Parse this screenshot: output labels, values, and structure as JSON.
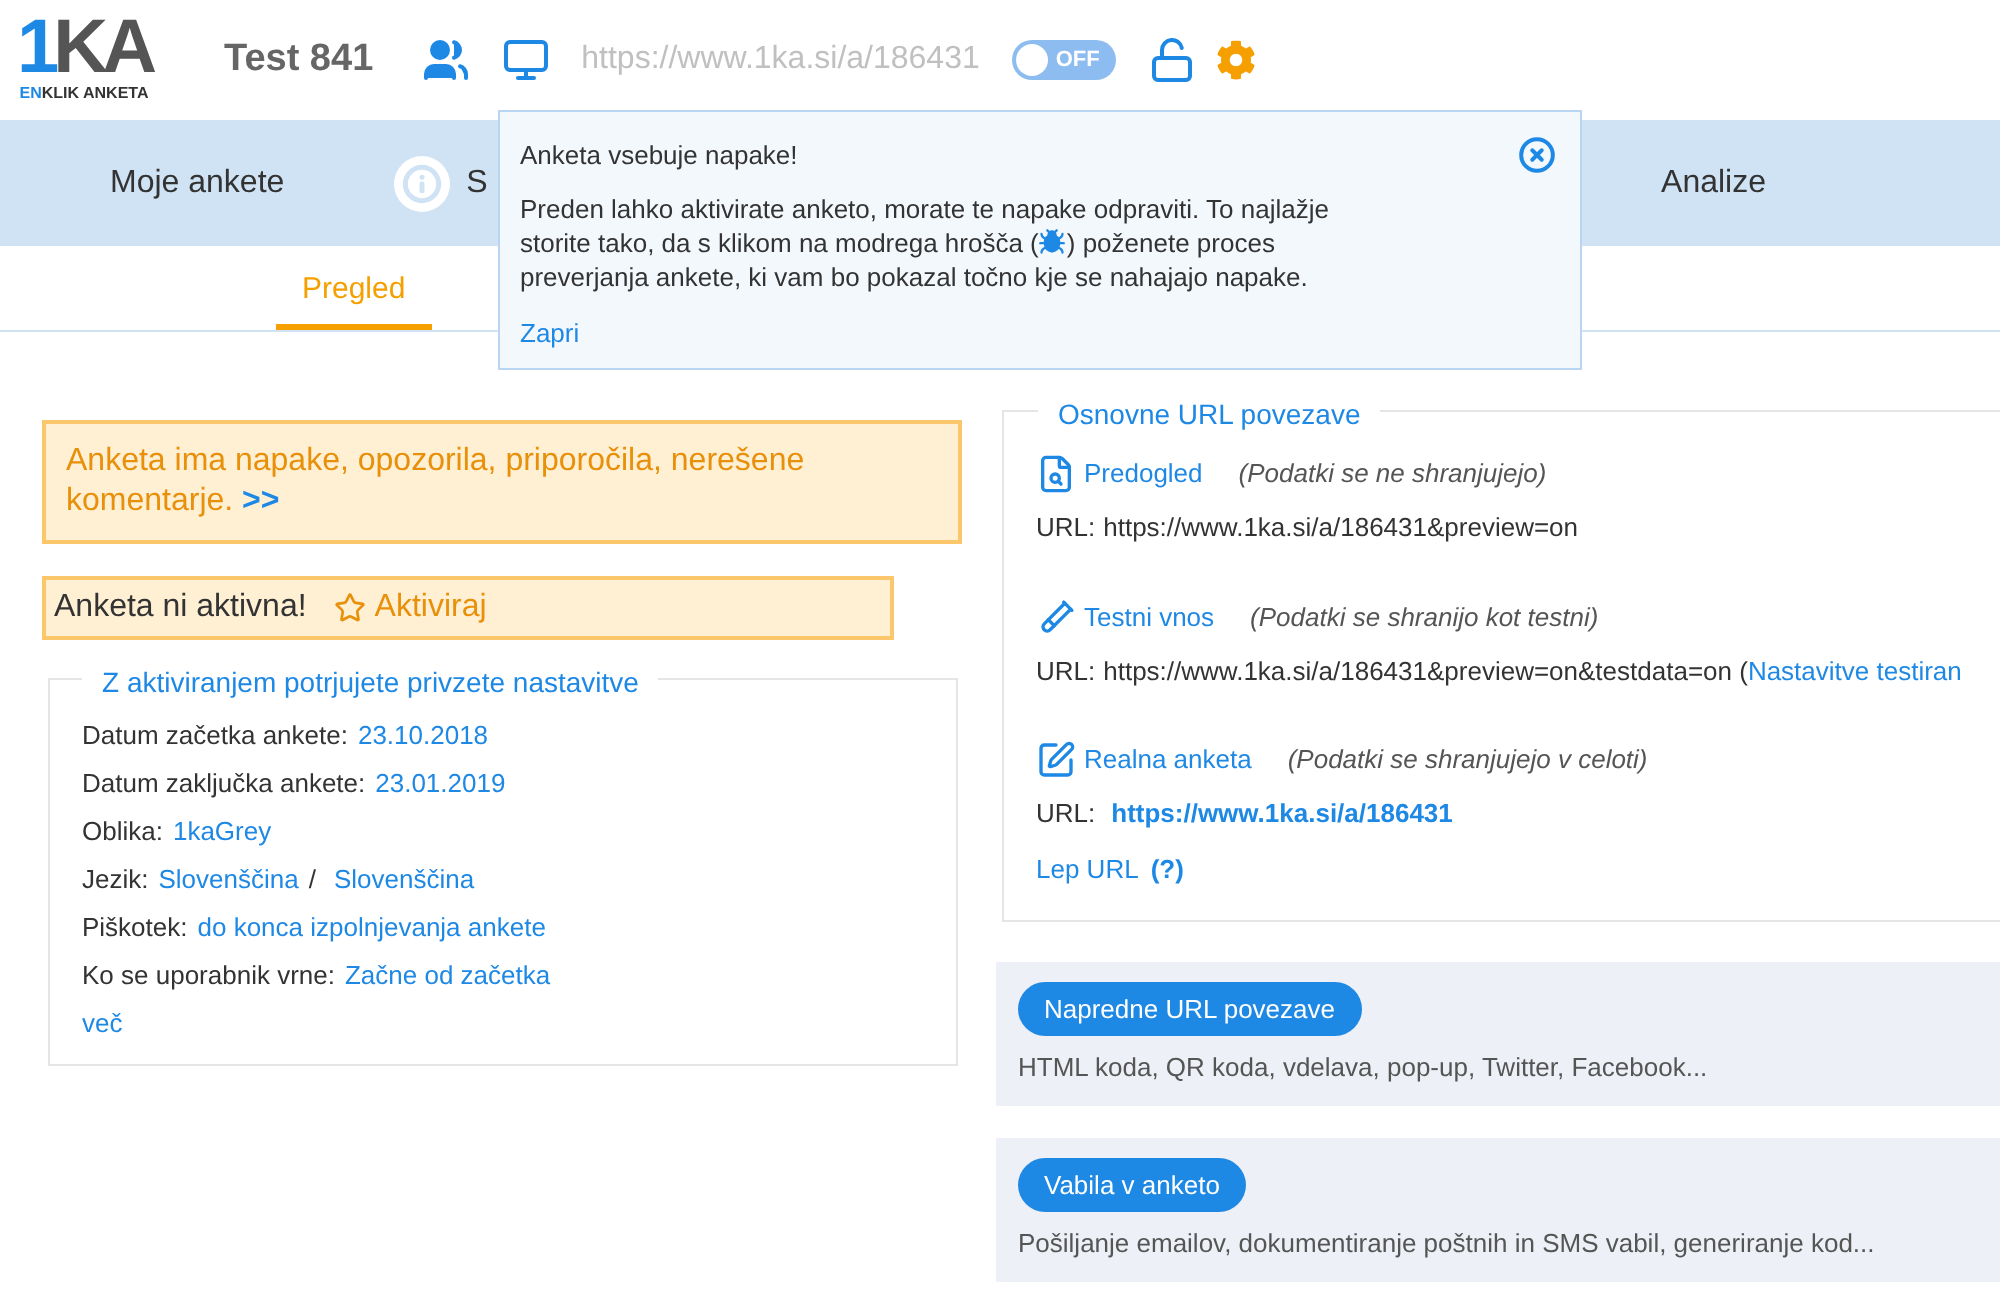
{
  "header": {
    "logo": {
      "mark": "1KA",
      "sub_accent": "EN",
      "sub_rest": "KLIK ANKETA"
    },
    "title": "Test 841",
    "url": "https://www.1ka.si/a/186431",
    "toggle": {
      "label": "OFF",
      "on": false
    }
  },
  "nav": {
    "items": [
      {
        "label": "Moje ankete",
        "kind": "plain"
      },
      {
        "label": "S",
        "kind": "info"
      },
      {
        "label": "Analize",
        "kind": "plain"
      }
    ]
  },
  "subtabs": [
    {
      "label": "Pregled",
      "selected": true
    }
  ],
  "popup": {
    "title": "Anketa vsebuje napake!",
    "message_lines": [
      {
        "before": "Preden lahko aktivirate anketo, morate te napake odpraviti. To najlažje"
      },
      {
        "before": "storite tako, da s klikom na modrega hrošča (",
        "after": ") poženete proces"
      },
      {
        "before": "preverjanja ankete, ki vam bo pokazal točno kje se nahajajo napake."
      }
    ],
    "close_link": "Zapri"
  },
  "warning": {
    "text": "Anketa ima napake, opozorila, priporočila, nerešene komentarje.",
    "link": ">>"
  },
  "status": {
    "text": "Anketa ni aktivna!",
    "action": "Aktiviraj"
  },
  "settings": {
    "legend": "Z aktiviranjem potrjujete privzete nastavitve",
    "separator": "/",
    "rows": [
      {
        "label": "Datum začetka ankete:",
        "values": [
          "23.10.2018"
        ]
      },
      {
        "label": "Datum zaključka ankete:",
        "values": [
          "23.01.2019"
        ]
      },
      {
        "label": "Oblika:",
        "values": [
          "1kaGrey"
        ]
      },
      {
        "label": "Jezik:",
        "values": [
          "Slovenščina",
          "Slovenščina"
        ]
      },
      {
        "label": "Piškotek:",
        "values": [
          "do konca izpolnjevanja ankete"
        ]
      },
      {
        "label": "Ko se uporabnik vrne:",
        "values": [
          "Začne od začetka"
        ]
      }
    ],
    "more": "več"
  },
  "urls": {
    "legend": "Osnovne URL povezave",
    "items": [
      {
        "kind": "preview",
        "link": "Predogled",
        "note": "(Podatki se ne shranjujejo)",
        "url_label": "URL:",
        "url": "https://www.1ka.si/a/186431&preview=on"
      },
      {
        "kind": "test",
        "link": "Testni vnos",
        "note": "(Podatki se shranijo kot testni)",
        "url_label": "URL:",
        "url": "https://www.1ka.si/a/186431&preview=on&testdata=on (",
        "extra_link": "Nastavitve testiran"
      },
      {
        "kind": "real",
        "link": "Realna anketa",
        "note": "(Podatki se shranjujejo v celoti)",
        "url_label": "URL:",
        "url_link": "https://www.1ka.si/a/186431"
      }
    ],
    "lep_url": "Lep URL",
    "help": "(?)"
  },
  "cards": [
    {
      "button": "Napredne URL povezave",
      "description": "HTML koda, QR koda, vdelava, pop-up, Twitter, Facebook..."
    },
    {
      "button": "Vabila v anketo",
      "description": "Pošiljanje emailov, dokumentiranje poštnih in SMS vabil, generiranje kod..."
    }
  ]
}
